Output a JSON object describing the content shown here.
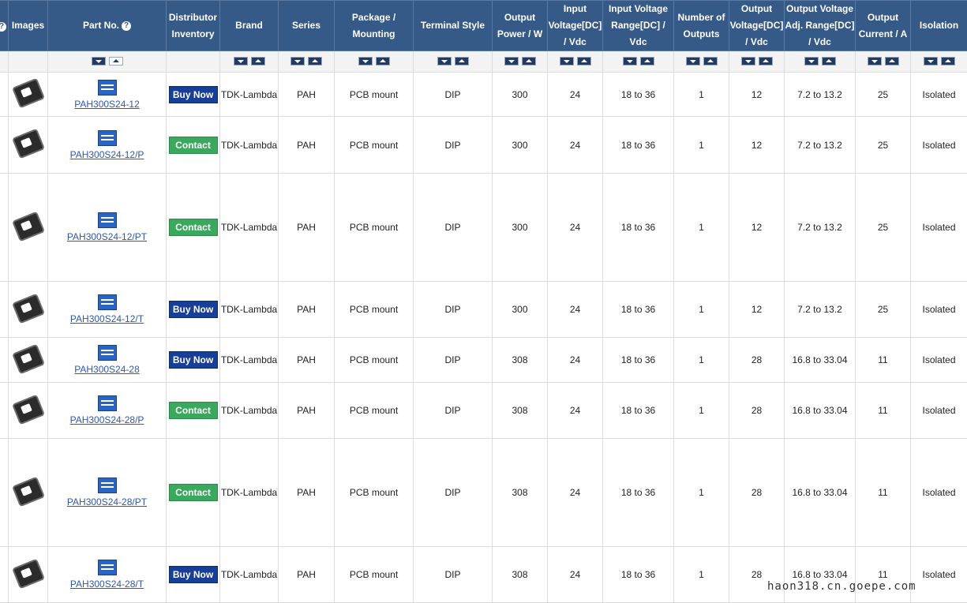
{
  "table": {
    "headers": [
      {
        "key": "spacer",
        "label": ""
      },
      {
        "key": "images",
        "label": "Images"
      },
      {
        "key": "part",
        "label": "Part No."
      },
      {
        "key": "inventory",
        "label": "Distributor Inventory"
      },
      {
        "key": "brand",
        "label": "Brand"
      },
      {
        "key": "series",
        "label": "Series"
      },
      {
        "key": "package",
        "label": "Package / Mounting"
      },
      {
        "key": "terminal",
        "label": "Terminal Style"
      },
      {
        "key": "power",
        "label": "Output Power / W"
      },
      {
        "key": "vin",
        "label": "Input Voltage[DC] / Vdc"
      },
      {
        "key": "vin_range",
        "label": "Input Voltage Range[DC] / Vdc"
      },
      {
        "key": "outputs",
        "label": "Number of Outputs"
      },
      {
        "key": "vout",
        "label": "Output Voltage[DC] / Vdc"
      },
      {
        "key": "vout_range",
        "label": "Output Voltage Adj. Range[DC] / Vdc"
      },
      {
        "key": "iout",
        "label": "Output Current / A"
      },
      {
        "key": "isolation",
        "label": "Isolation"
      }
    ],
    "rows": [
      {
        "part": "PAH300S24-12",
        "action": "Buy Now",
        "action_type": "buy",
        "brand": "TDK-Lambda",
        "series": "PAH",
        "package": "PCB mount",
        "terminal": "DIP",
        "power": "300",
        "vin": "24",
        "vin_range": "18 to 36",
        "outputs": "1",
        "vout": "12",
        "vout_range": "7.2 to 13.2",
        "iout": "25",
        "isolation": "Isolated"
      },
      {
        "part": "PAH300S24-12/P",
        "action": "Contact",
        "action_type": "contact",
        "brand": "TDK-Lambda",
        "series": "PAH",
        "package": "PCB mount",
        "terminal": "DIP",
        "power": "300",
        "vin": "24",
        "vin_range": "18 to 36",
        "outputs": "1",
        "vout": "12",
        "vout_range": "7.2 to 13.2",
        "iout": "25",
        "isolation": "Isolated"
      },
      {
        "part": "PAH300S24-12/PT",
        "action": "Contact",
        "action_type": "contact",
        "brand": "TDK-Lambda",
        "series": "PAH",
        "package": "PCB mount",
        "terminal": "DIP",
        "power": "300",
        "vin": "24",
        "vin_range": "18 to 36",
        "outputs": "1",
        "vout": "12",
        "vout_range": "7.2 to 13.2",
        "iout": "25",
        "isolation": "Isolated"
      },
      {
        "part": "PAH300S24-12/T",
        "action": "Buy Now",
        "action_type": "buy",
        "brand": "TDK-Lambda",
        "series": "PAH",
        "package": "PCB mount",
        "terminal": "DIP",
        "power": "300",
        "vin": "24",
        "vin_range": "18 to 36",
        "outputs": "1",
        "vout": "12",
        "vout_range": "7.2 to 13.2",
        "iout": "25",
        "isolation": "Isolated"
      },
      {
        "part": "PAH300S24-28",
        "action": "Buy Now",
        "action_type": "buy",
        "brand": "TDK-Lambda",
        "series": "PAH",
        "package": "PCB mount",
        "terminal": "DIP",
        "power": "308",
        "vin": "24",
        "vin_range": "18 to 36",
        "outputs": "1",
        "vout": "28",
        "vout_range": "16.8 to 33.04",
        "iout": "11",
        "isolation": "Isolated"
      },
      {
        "part": "PAH300S24-28/P",
        "action": "Contact",
        "action_type": "contact",
        "brand": "TDK-Lambda",
        "series": "PAH",
        "package": "PCB mount",
        "terminal": "DIP",
        "power": "308",
        "vin": "24",
        "vin_range": "18 to 36",
        "outputs": "1",
        "vout": "28",
        "vout_range": "16.8 to 33.04",
        "iout": "11",
        "isolation": "Isolated"
      },
      {
        "part": "PAH300S24-28/PT",
        "action": "Contact",
        "action_type": "contact",
        "brand": "TDK-Lambda",
        "series": "PAH",
        "package": "PCB mount",
        "terminal": "DIP",
        "power": "308",
        "vin": "24",
        "vin_range": "18 to 36",
        "outputs": "1",
        "vout": "28",
        "vout_range": "16.8 to 33.04",
        "iout": "11",
        "isolation": "Isolated"
      },
      {
        "part": "PAH300S24-28/T",
        "action": "Buy Now",
        "action_type": "buy",
        "brand": "TDK-Lambda",
        "series": "PAH",
        "package": "PCB mount",
        "terminal": "DIP",
        "power": "308",
        "vin": "24",
        "vin_range": "18 to 36",
        "outputs": "1",
        "vout": "28",
        "vout_range": "16.8 to 33.04",
        "iout": "11",
        "isolation": "Isolated"
      }
    ]
  },
  "icons": {
    "help": "help-circle-icon",
    "sort_down": "sort-descending-icon",
    "sort_up": "sort-ascending-icon",
    "product": "product-image-icon",
    "datasheet": "datasheet-icon"
  },
  "watermark": "haon318.cn.goepe.com",
  "colors": {
    "header_bg": "#355a87",
    "buy_button": "#173f9a",
    "contact_button": "#3aa85d",
    "link": "#2a57b6"
  }
}
